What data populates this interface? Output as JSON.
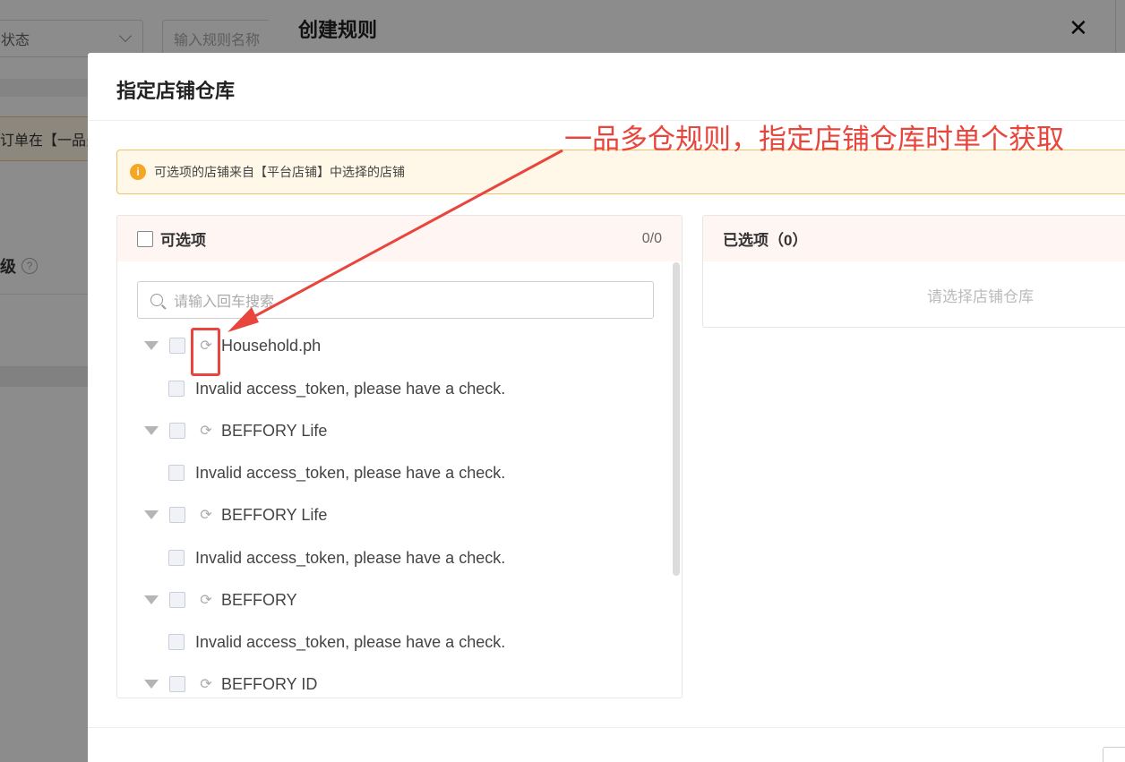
{
  "background": {
    "status_select": "状态",
    "rule_name_placeholder": "输入规则名称",
    "notice_text": "订单在【一品多",
    "level_label": "级"
  },
  "drawer": {
    "title": "创建规则",
    "close": "✕"
  },
  "modal": {
    "title": "指定店铺仓库",
    "alert": "可选项的店铺来自【平台店铺】中选择的店铺",
    "available": {
      "header": "可选项",
      "count": "0/0",
      "search_placeholder": "请输入回车搜索",
      "tree": [
        {
          "name": "Household.ph",
          "child": "Invalid access_token, please have a check."
        },
        {
          "name": "BEFFORY Life",
          "child": "Invalid access_token, please have a check."
        },
        {
          "name": "BEFFORY Life",
          "child": "Invalid access_token, please have a check."
        },
        {
          "name": "BEFFORY",
          "child": "Invalid access_token, please have a check."
        },
        {
          "name": "BEFFORY ID",
          "child": ""
        }
      ]
    },
    "selected": {
      "header": "已选项（0）",
      "empty": "请选择店铺仓库"
    }
  },
  "annotation": {
    "text": "一品多仓规则，指定店铺仓库时单个获取",
    "color": "#e8453c"
  },
  "icons": {
    "sync": "⟳",
    "info": "i"
  }
}
